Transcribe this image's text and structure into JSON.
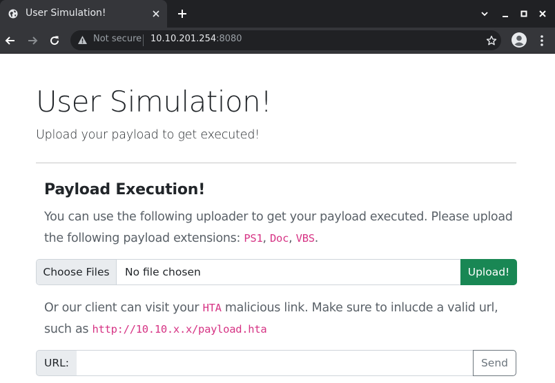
{
  "browser": {
    "tab_title": "User Simulation!",
    "security_label": "Not secure",
    "url_host": "10.10.201.254",
    "url_port": ":8080"
  },
  "page": {
    "title": "User Simulation!",
    "lead": "Upload your payload to get executed!",
    "section_title": "Payload Execution!",
    "para1_line1": "You can use the following uploader to get your payload executed. Please upload",
    "para1_line2_prefix": "the following payload extensions: ",
    "ext1": "PS1",
    "sep1": ", ",
    "ext2": "Doc",
    "sep2": ", ",
    "ext3": "VBS",
    "para1_end": ".",
    "file_choose_label": "Choose Files",
    "file_status": "No file chosen",
    "upload_label": "Upload!",
    "para2_prefix": "Or our client can visit your ",
    "para2_code": "HTA",
    "para2_suffix": " malicious link. Make sure to inlucde a valid url,",
    "para3_prefix": "such as ",
    "para3_code": "http://10.10.x.x/payload.hta",
    "url_label": "URL:",
    "url_value": "",
    "send_label": "Send"
  },
  "colors": {
    "upload_button": "#198754",
    "code": "#d63384",
    "browser_dark": "#202124",
    "browser_toolbar": "#35363a"
  },
  "icons": [
    "globe-icon",
    "close-icon",
    "plus-icon",
    "chevron-down-icon",
    "minimize-icon",
    "maximize-icon",
    "window-close-icon",
    "back-arrow-icon",
    "forward-arrow-icon",
    "reload-icon",
    "warning-icon",
    "star-icon",
    "avatar-icon",
    "more-vert-icon"
  ]
}
